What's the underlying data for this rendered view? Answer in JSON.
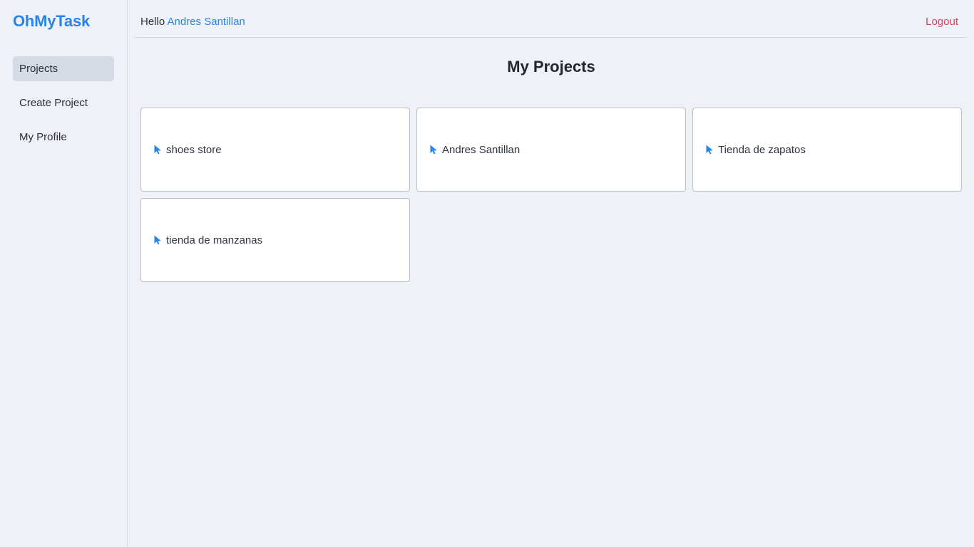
{
  "brand": {
    "name": "OhMyTask",
    "color": "#2b83ea"
  },
  "sidebar": {
    "items": [
      {
        "label": "Projects",
        "active": true
      },
      {
        "label": "Create Project",
        "active": false
      },
      {
        "label": "My Profile",
        "active": false
      }
    ]
  },
  "header": {
    "greeting": "Hello",
    "user_name": "Andres Santillan",
    "logout_label": "Logout",
    "logout_color": "#e03e5a"
  },
  "main": {
    "title": "My Projects",
    "projects": [
      {
        "name": "shoes store",
        "icon": "cursor-pointer-icon"
      },
      {
        "name": "Andres Santillan",
        "icon": "cursor-pointer-icon"
      },
      {
        "name": "Tienda de zapatos",
        "icon": "cursor-pointer-icon"
      },
      {
        "name": "tienda de manzanas",
        "icon": "cursor-pointer-icon"
      }
    ]
  }
}
